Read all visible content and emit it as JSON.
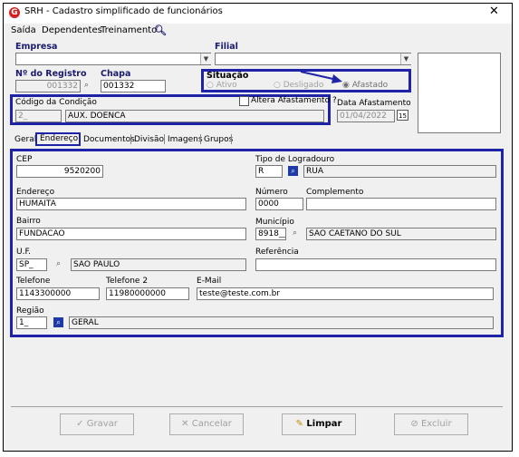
{
  "window": {
    "title": "SRH - Cadastro simplificado de funcionários",
    "logo_letter": "G"
  },
  "menu": [
    "Saída",
    "Dependentes",
    "Treinamento"
  ],
  "header": {
    "empresa_label": "Empresa",
    "filial_label": "Filial",
    "registro_label": "Nº do Registro",
    "registro_value": "001332",
    "chapa_label": "Chapa",
    "chapa_value": "001332",
    "situacao_label": "Situação",
    "situacao_options": [
      "Ativo",
      "Desligado",
      "Afastado"
    ],
    "situacao_selected": "Afastado",
    "condicao_label": "Código da Condição",
    "condicao_code": "2_",
    "condicao_desc": "AUX. DOENCA",
    "altera_label": "Altera Afastamento ?",
    "data_afast_label": "Data Afastamento",
    "data_afast_value": "01/04/2022"
  },
  "tabs": [
    "Geral",
    "Endereço",
    "Documentos",
    "Divisão",
    "Imagens",
    "Grupos"
  ],
  "active_tab": "Endereço",
  "address": {
    "cep_label": "CEP",
    "cep_value": "9520200",
    "tipo_label": "Tipo de Logradouro",
    "tipo_code": "R",
    "tipo_desc": "RUA",
    "endereco_label": "Endereço",
    "endereco_value": "HUMAITA",
    "numero_label": "Número",
    "numero_value": "0000",
    "complemento_label": "Complemento",
    "complemento_value": "",
    "bairro_label": "Bairro",
    "bairro_value": "FUNDACAO",
    "municipio_label": "Município",
    "municipio_code": "8918__",
    "municipio_desc": "SAO CAETANO DO SUL",
    "uf_label": "U.F.",
    "uf_code": "SP_",
    "uf_desc": "SAO PAULO",
    "referencia_label": "Referência",
    "referencia_value": "",
    "telefone_label": "Telefone",
    "telefone_value": "1143300000",
    "telefone2_label": "Telefone 2",
    "telefone2_value": "11980000000",
    "email_label": "E-Mail",
    "email_value": "teste@teste.com.br",
    "regiao_label": "Região",
    "regiao_code": "1_",
    "regiao_desc": "GERAL"
  },
  "buttons": {
    "gravar": "Gravar",
    "cancelar": "Cancelar",
    "limpar": "Limpar",
    "excluir": "Excluir"
  },
  "colors": {
    "highlight": "#1f23a8",
    "label_blue": "#1a1a6e",
    "logo": "#d42020"
  }
}
